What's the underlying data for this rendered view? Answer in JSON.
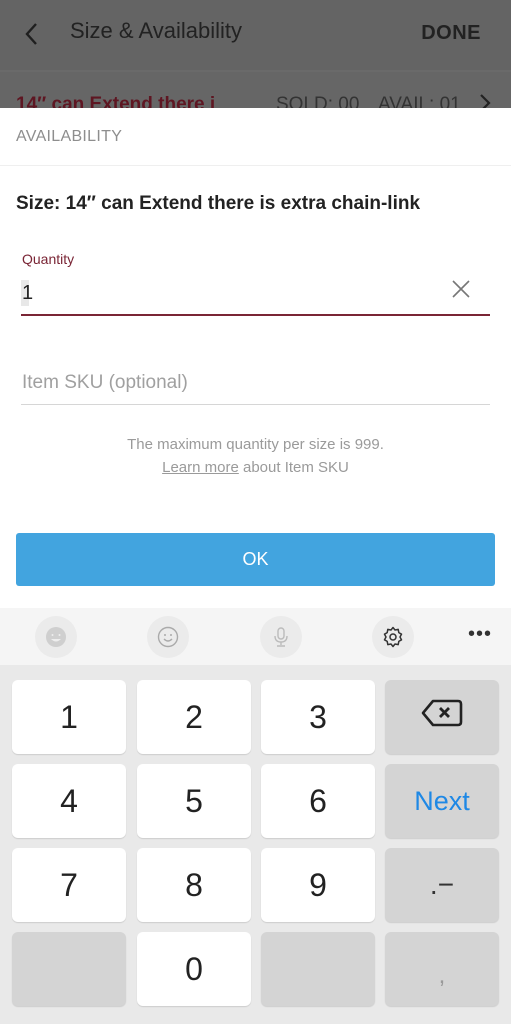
{
  "background": {
    "header": {
      "back_icon": "chevron-left-icon",
      "title": "Size & Availability",
      "done_label": "DONE"
    },
    "row": {
      "title": "14″ can Extend there i",
      "sold": "SOLD: 00",
      "avail": "AVAIL: 01",
      "chevron_icon": "chevron-right-icon"
    }
  },
  "sheet": {
    "section_title": "AVAILABILITY",
    "size_label": "Size: 14″ can Extend there is extra chain-link",
    "quantity": {
      "label": "Quantity",
      "value": "1",
      "clear_icon": "close-icon"
    },
    "sku": {
      "placeholder": "Item SKU (optional)",
      "value": ""
    },
    "hint": {
      "line1": "The maximum quantity per size is 999.",
      "link": "Learn more",
      "line2_rest": " about Item SKU"
    },
    "ok_label": "OK",
    "colors": {
      "accent": "#7a2535",
      "ok_button": "#42a4df"
    }
  },
  "keyboard": {
    "toolbar": [
      {
        "name": "sticker-icon"
      },
      {
        "name": "emoji-icon"
      },
      {
        "name": "microphone-icon"
      },
      {
        "name": "settings-gear-icon"
      },
      {
        "name": "more-icon",
        "label": "•••"
      }
    ],
    "keys": {
      "k1": "1",
      "k2": "2",
      "k3": "3",
      "k4": "4",
      "k5": "5",
      "k6": "6",
      "k7": "7",
      "k8": "8",
      "k9": "9",
      "k0": "0",
      "next": "Next",
      "dot_dash": ".−",
      "comma": ","
    },
    "next_color": "#1e88e5"
  }
}
